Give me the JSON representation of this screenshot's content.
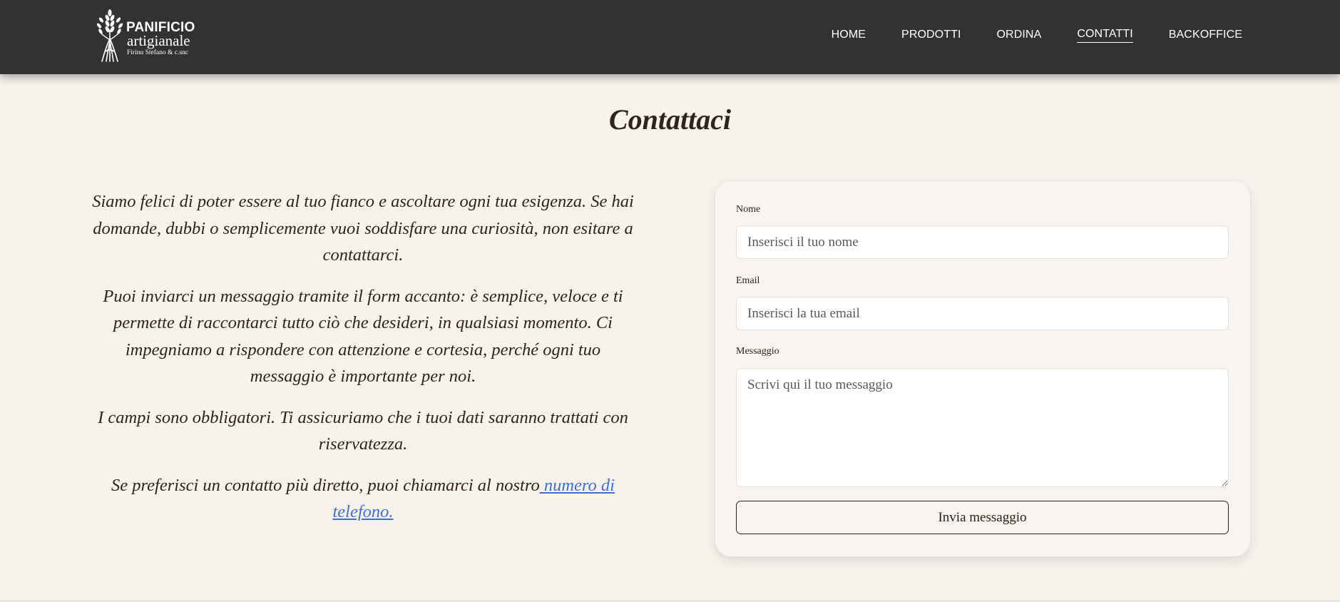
{
  "header": {
    "logo": {
      "line1": "PANIFICIO",
      "line2": "artigianale",
      "line3": "Firinu Stefano & c.snc"
    },
    "nav": [
      {
        "label": "HOME",
        "active": false
      },
      {
        "label": "PRODOTTI",
        "active": false
      },
      {
        "label": "ORDINA",
        "active": false
      },
      {
        "label": "CONTATTI",
        "active": true
      },
      {
        "label": "BACKOFFICE",
        "active": false
      }
    ]
  },
  "main": {
    "title": "Contattaci",
    "paragraphs": [
      "Siamo felici di poter essere al tuo fianco e ascoltare ogni tua esigenza. Se hai domande, dubbi o semplicemente vuoi soddisfare una curiosità, non esitare a contattarci.",
      "Puoi inviarci un messaggio tramite il form accanto: è semplice, veloce e ti permette di raccontarci tutto ciò che desideri, in qualsiasi momento. Ci impegniamo a rispondere con attenzione e cortesia, perché ogni tuo messaggio è importante per noi.",
      "I campi sono obbligatori. Ti assicuriamo che i tuoi dati saranno trattati con riservatezza."
    ],
    "phone_paragraph": {
      "text": "Se preferisci un contatto più diretto, puoi chiamarci al nostro",
      "link": " numero di telefono."
    }
  },
  "form": {
    "name_label": "Nome",
    "name_placeholder": "Inserisci il tuo nome",
    "name_value": "",
    "email_label": "Email",
    "email_placeholder": "Inserisci la tua email",
    "email_value": "",
    "message_label": "Messaggio",
    "message_placeholder": "Scrivi qui il tuo messaggio",
    "message_value": "",
    "submit_label": "Invia messaggio"
  },
  "colors": {
    "navbar": "#333231",
    "page_background": "#f8f2ec",
    "link": "#3d6fd6",
    "text": "#2f2417"
  }
}
